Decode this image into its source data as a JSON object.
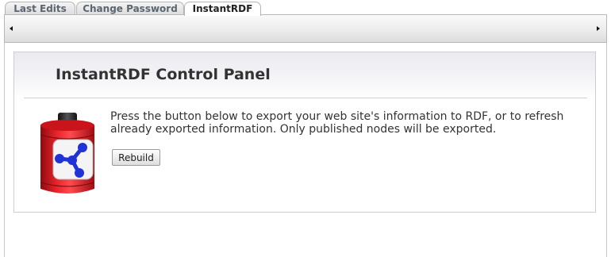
{
  "tabs": [
    {
      "label": "Last Edits",
      "active": false
    },
    {
      "label": "Change Password",
      "active": false
    },
    {
      "label": "InstantRDF",
      "active": true
    }
  ],
  "panel": {
    "title": "InstantRDF Control Panel",
    "description": "Press the button below to export your web site's information to RDF, or to refresh already exported information. Only published nodes will be exported.",
    "button_label": "Rebuild"
  },
  "icons": {
    "scroll_left": "arrow-left-icon",
    "scroll_right": "arrow-right-icon",
    "logo": "rdf-logo-icon"
  },
  "colors": {
    "logo_red": "#d9161c",
    "logo_blue": "#1f33d6"
  }
}
